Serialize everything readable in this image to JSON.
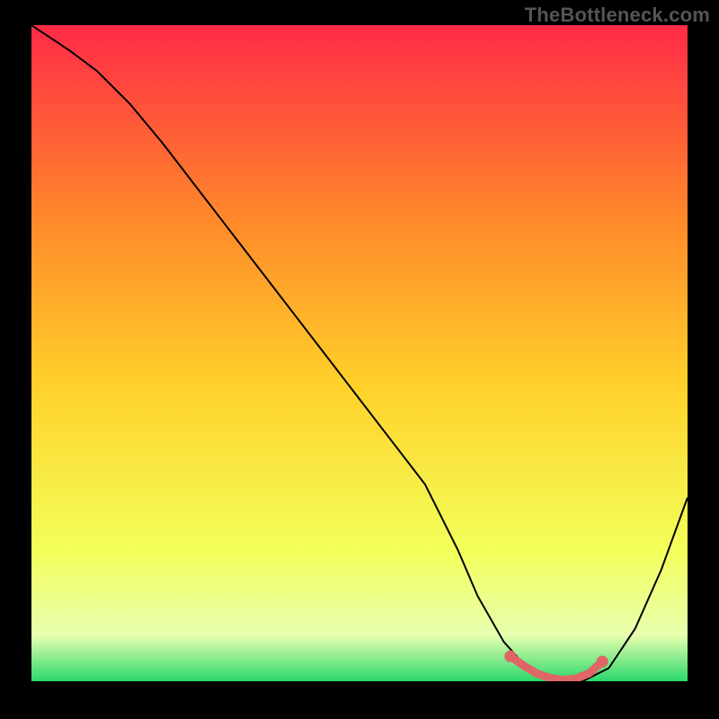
{
  "watermark": "TheBottleneck.com",
  "colors": {
    "gradient_top": "#ff2a47",
    "gradient_upper_mid": "#ff8a2a",
    "gradient_mid": "#ffd12a",
    "gradient_lower_mid": "#f3ff5a",
    "gradient_low": "#e8ffb0",
    "gradient_bottom": "#2bd86b",
    "curve": "#000000",
    "marker": "#e06666"
  },
  "chart_data": {
    "type": "line",
    "title": "",
    "xlabel": "",
    "ylabel": "",
    "xlim": [
      0,
      100
    ],
    "ylim": [
      0,
      100
    ],
    "grid": false,
    "series": [
      {
        "name": "bottleneck-curve",
        "x": [
          0,
          3,
          6,
          10,
          15,
          20,
          25,
          30,
          35,
          40,
          45,
          50,
          55,
          60,
          62,
          65,
          68,
          72,
          76,
          80,
          84,
          88,
          92,
          96,
          100
        ],
        "values": [
          100,
          98,
          96,
          93,
          88,
          82,
          75.5,
          69,
          62.5,
          56,
          49.5,
          43,
          36.5,
          30,
          26,
          20,
          13,
          6,
          1.5,
          0,
          0,
          2,
          8,
          17,
          28
        ]
      }
    ],
    "markers": {
      "name": "optimal-range",
      "x": [
        73,
        75,
        77,
        79,
        81,
        83,
        85,
        87
      ],
      "values": [
        3.8,
        2.4,
        1.2,
        0.5,
        0.2,
        0.4,
        1.2,
        3.0
      ]
    }
  }
}
